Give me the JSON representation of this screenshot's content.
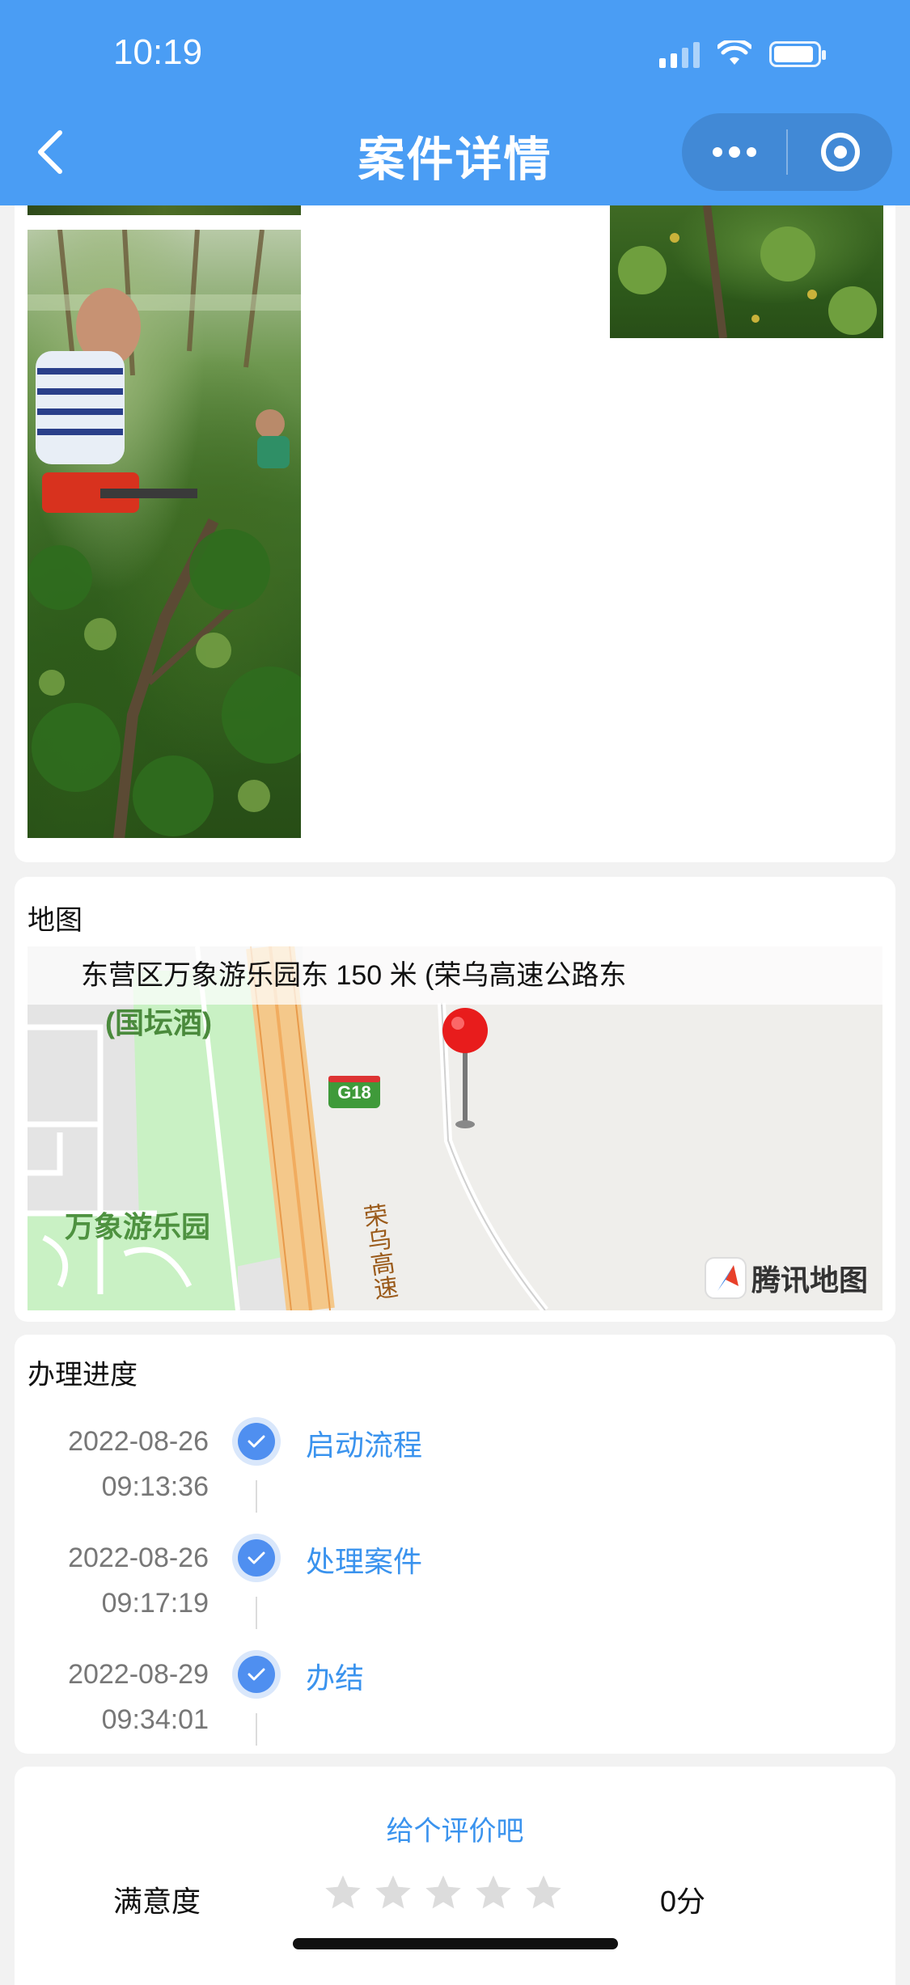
{
  "status_bar": {
    "time": "10:19"
  },
  "header": {
    "title": "案件详情"
  },
  "map_section": {
    "title": "地图",
    "address": "东营区万象游乐园东 150 米 (荣乌高速公路东",
    "places": {
      "partial_top": "(国坛酒)",
      "park": "万象游乐园",
      "highway_shield": "G18",
      "highway_name": "荣乌高速"
    },
    "provider": "腾讯地图"
  },
  "progress": {
    "title": "办理进度",
    "steps": [
      {
        "date": "2022-08-26",
        "time": "09:13:36",
        "name": "启动流程"
      },
      {
        "date": "2022-08-26",
        "time": "09:17:19",
        "name": "处理案件"
      },
      {
        "date": "2022-08-29",
        "time": "09:34:01",
        "name": "办结"
      }
    ]
  },
  "rating": {
    "prompt": "给个评价吧",
    "label": "满意度",
    "stars": 0,
    "max_stars": 5,
    "score": "0分"
  },
  "colors": {
    "header": "#4a9df4",
    "accent": "#3a93ee",
    "check": "#4f8ff0"
  }
}
